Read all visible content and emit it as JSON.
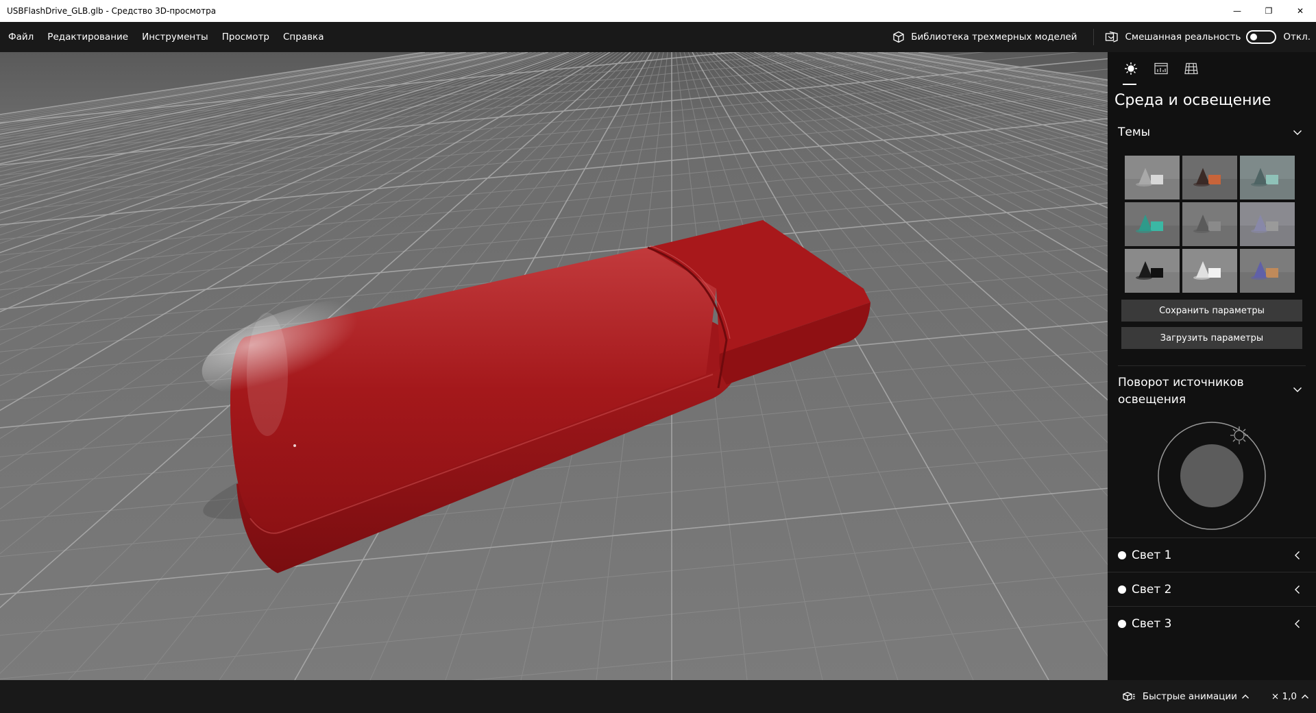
{
  "window": {
    "title": "USBFlashDrive_GLB.glb - Средство 3D-просмотра",
    "minimize_glyph": "—",
    "restore_glyph": "❐",
    "close_glyph": "✕"
  },
  "menu": {
    "items": [
      "Файл",
      "Редактирование",
      "Инструменты",
      "Просмотр",
      "Справка"
    ],
    "library_label": "Библиотека трехмерных моделей",
    "mixed_reality_label": "Смешанная реальность",
    "mixed_reality_state": "Откл."
  },
  "panel": {
    "tabs": [
      "sun-icon",
      "stats-icon",
      "grid-icon"
    ],
    "title": "Среда и освещение",
    "themes_label": "Темы",
    "theme_tiles": [
      {
        "bg": "#8a8a8a",
        "cone": "#a9a9a9",
        "box": "#d8d8d8"
      },
      {
        "bg": "#6d6d6d",
        "cone": "#3a2a26",
        "box": "#c8643a"
      },
      {
        "bg": "#7e8a8a",
        "cone": "#4f6464",
        "box": "#8fc2b8"
      },
      {
        "bg": "#737373",
        "cone": "#2f9a8a",
        "box": "#3bb8a4"
      },
      {
        "bg": "#7a7a7a",
        "cone": "#5a5a5a",
        "box": "#8a8a8a"
      },
      {
        "bg": "#8a8a90",
        "cone": "#8888a8",
        "box": "#9a9a9a"
      },
      {
        "bg": "#8a8a8a",
        "cone": "#1a1a1a",
        "box": "#111111"
      },
      {
        "bg": "#8c8c8c",
        "cone": "#e0e0e0",
        "box": "#f2f2f2"
      },
      {
        "bg": "#7c7c7c",
        "cone": "#6060a8",
        "box": "#c08a5a"
      }
    ],
    "save_label": "Сохранить параметры",
    "load_label": "Загрузить параметры",
    "rotation_label": "Поворот источников освещения",
    "lights": [
      "Свет 1",
      "Свет 2",
      "Свет 3"
    ]
  },
  "bottom": {
    "animations_label": "Быстрые анимации",
    "speed_label": "× 1,0"
  },
  "colors": {
    "model_red": "#a3171a",
    "panel_bg": "#111111",
    "menubar_bg": "#191919"
  }
}
